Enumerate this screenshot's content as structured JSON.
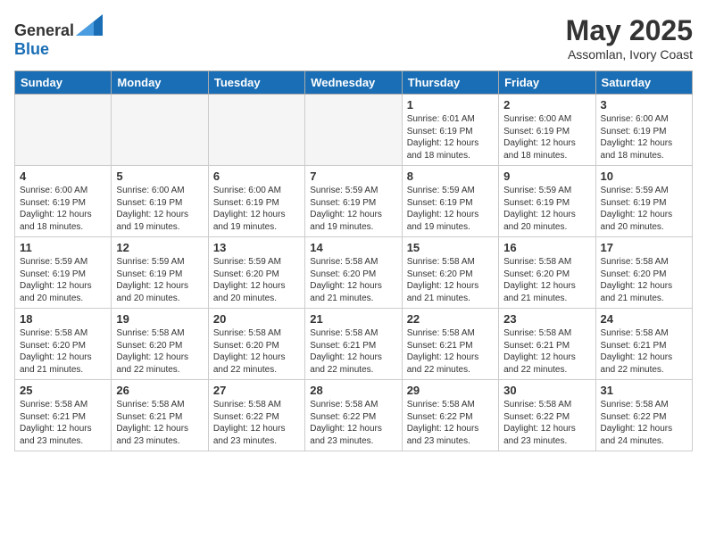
{
  "header": {
    "logo": {
      "general": "General",
      "blue": "Blue"
    },
    "month": "May 2025",
    "location": "Assomlan, Ivory Coast"
  },
  "weekdays": [
    "Sunday",
    "Monday",
    "Tuesday",
    "Wednesday",
    "Thursday",
    "Friday",
    "Saturday"
  ],
  "weeks": [
    [
      {
        "day": "",
        "info": ""
      },
      {
        "day": "",
        "info": ""
      },
      {
        "day": "",
        "info": ""
      },
      {
        "day": "",
        "info": ""
      },
      {
        "day": "1",
        "info": "Sunrise: 6:01 AM\nSunset: 6:19 PM\nDaylight: 12 hours\nand 18 minutes."
      },
      {
        "day": "2",
        "info": "Sunrise: 6:00 AM\nSunset: 6:19 PM\nDaylight: 12 hours\nand 18 minutes."
      },
      {
        "day": "3",
        "info": "Sunrise: 6:00 AM\nSunset: 6:19 PM\nDaylight: 12 hours\nand 18 minutes."
      }
    ],
    [
      {
        "day": "4",
        "info": "Sunrise: 6:00 AM\nSunset: 6:19 PM\nDaylight: 12 hours\nand 18 minutes."
      },
      {
        "day": "5",
        "info": "Sunrise: 6:00 AM\nSunset: 6:19 PM\nDaylight: 12 hours\nand 19 minutes."
      },
      {
        "day": "6",
        "info": "Sunrise: 6:00 AM\nSunset: 6:19 PM\nDaylight: 12 hours\nand 19 minutes."
      },
      {
        "day": "7",
        "info": "Sunrise: 5:59 AM\nSunset: 6:19 PM\nDaylight: 12 hours\nand 19 minutes."
      },
      {
        "day": "8",
        "info": "Sunrise: 5:59 AM\nSunset: 6:19 PM\nDaylight: 12 hours\nand 19 minutes."
      },
      {
        "day": "9",
        "info": "Sunrise: 5:59 AM\nSunset: 6:19 PM\nDaylight: 12 hours\nand 20 minutes."
      },
      {
        "day": "10",
        "info": "Sunrise: 5:59 AM\nSunset: 6:19 PM\nDaylight: 12 hours\nand 20 minutes."
      }
    ],
    [
      {
        "day": "11",
        "info": "Sunrise: 5:59 AM\nSunset: 6:19 PM\nDaylight: 12 hours\nand 20 minutes."
      },
      {
        "day": "12",
        "info": "Sunrise: 5:59 AM\nSunset: 6:19 PM\nDaylight: 12 hours\nand 20 minutes."
      },
      {
        "day": "13",
        "info": "Sunrise: 5:59 AM\nSunset: 6:20 PM\nDaylight: 12 hours\nand 20 minutes."
      },
      {
        "day": "14",
        "info": "Sunrise: 5:58 AM\nSunset: 6:20 PM\nDaylight: 12 hours\nand 21 minutes."
      },
      {
        "day": "15",
        "info": "Sunrise: 5:58 AM\nSunset: 6:20 PM\nDaylight: 12 hours\nand 21 minutes."
      },
      {
        "day": "16",
        "info": "Sunrise: 5:58 AM\nSunset: 6:20 PM\nDaylight: 12 hours\nand 21 minutes."
      },
      {
        "day": "17",
        "info": "Sunrise: 5:58 AM\nSunset: 6:20 PM\nDaylight: 12 hours\nand 21 minutes."
      }
    ],
    [
      {
        "day": "18",
        "info": "Sunrise: 5:58 AM\nSunset: 6:20 PM\nDaylight: 12 hours\nand 21 minutes."
      },
      {
        "day": "19",
        "info": "Sunrise: 5:58 AM\nSunset: 6:20 PM\nDaylight: 12 hours\nand 22 minutes."
      },
      {
        "day": "20",
        "info": "Sunrise: 5:58 AM\nSunset: 6:20 PM\nDaylight: 12 hours\nand 22 minutes."
      },
      {
        "day": "21",
        "info": "Sunrise: 5:58 AM\nSunset: 6:21 PM\nDaylight: 12 hours\nand 22 minutes."
      },
      {
        "day": "22",
        "info": "Sunrise: 5:58 AM\nSunset: 6:21 PM\nDaylight: 12 hours\nand 22 minutes."
      },
      {
        "day": "23",
        "info": "Sunrise: 5:58 AM\nSunset: 6:21 PM\nDaylight: 12 hours\nand 22 minutes."
      },
      {
        "day": "24",
        "info": "Sunrise: 5:58 AM\nSunset: 6:21 PM\nDaylight: 12 hours\nand 22 minutes."
      }
    ],
    [
      {
        "day": "25",
        "info": "Sunrise: 5:58 AM\nSunset: 6:21 PM\nDaylight: 12 hours\nand 23 minutes."
      },
      {
        "day": "26",
        "info": "Sunrise: 5:58 AM\nSunset: 6:21 PM\nDaylight: 12 hours\nand 23 minutes."
      },
      {
        "day": "27",
        "info": "Sunrise: 5:58 AM\nSunset: 6:22 PM\nDaylight: 12 hours\nand 23 minutes."
      },
      {
        "day": "28",
        "info": "Sunrise: 5:58 AM\nSunset: 6:22 PM\nDaylight: 12 hours\nand 23 minutes."
      },
      {
        "day": "29",
        "info": "Sunrise: 5:58 AM\nSunset: 6:22 PM\nDaylight: 12 hours\nand 23 minutes."
      },
      {
        "day": "30",
        "info": "Sunrise: 5:58 AM\nSunset: 6:22 PM\nDaylight: 12 hours\nand 23 minutes."
      },
      {
        "day": "31",
        "info": "Sunrise: 5:58 AM\nSunset: 6:22 PM\nDaylight: 12 hours\nand 24 minutes."
      }
    ]
  ]
}
